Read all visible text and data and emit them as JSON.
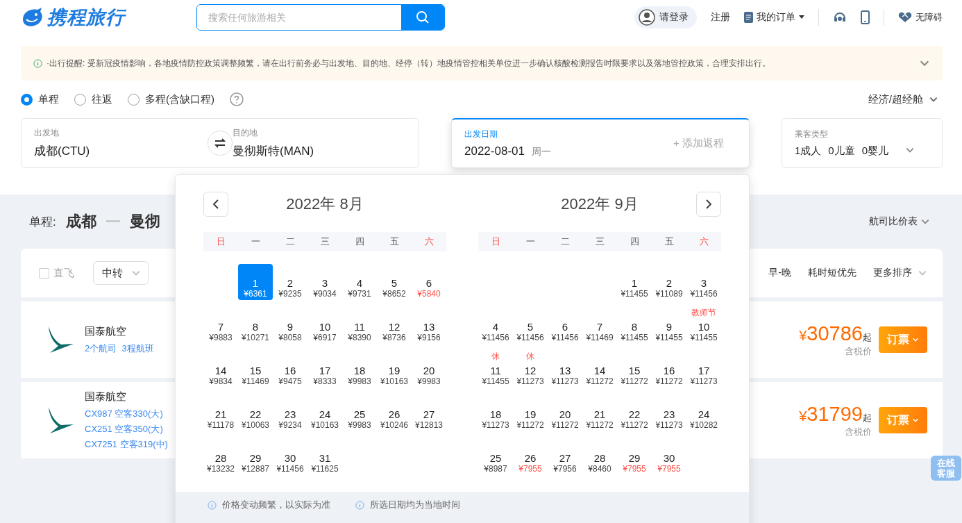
{
  "header": {
    "logo_text": "携程旅行",
    "search_placeholder": "搜索任何旅游相关",
    "login": "请登录",
    "register": "注册",
    "orders": "我的订单",
    "accessibility": "无障碍"
  },
  "notice": {
    "text": "·出行提醒: 受新冠疫情影响，各地疫情防控政策调整频繁，请在出行前务必与出发地、目的地、经停（转）地疫情管控相关单位进一步确认核酸检测报告时限要求以及落地管控政策，合理安排出行。"
  },
  "trip_types": [
    {
      "label": "单程",
      "selected": true
    },
    {
      "label": "往返",
      "selected": false
    },
    {
      "label": "多程(含缺口程)",
      "selected": false
    }
  ],
  "cabin": "经济/超经舱",
  "search": {
    "from": {
      "label": "出发地",
      "value": "成都(CTU)"
    },
    "to": {
      "label": "目的地",
      "value": "曼彻斯特(MAN)"
    },
    "date": {
      "label": "出发日期",
      "value": "2022-08-01",
      "weekday": "周一",
      "return": "+ 添加返程"
    },
    "passengers": {
      "label": "乘客类型",
      "values": [
        "1成人",
        "0儿童",
        "0婴儿"
      ]
    }
  },
  "results": {
    "trip_label": "单程:",
    "from": "成都",
    "to": "曼彻",
    "compare": "航司比价表",
    "direct": {
      "label": "直飞",
      "checked": false
    },
    "transfer": "中转",
    "sorts": [
      "早-晚",
      "耗时短优先",
      "更多排序"
    ],
    "flights": [
      {
        "airline": "国泰航空",
        "details": [
          "2个航司  3程航班"
        ],
        "currency": "¥",
        "amount": "30786",
        "suffix": "起",
        "tax": "含税价",
        "button": "订票"
      },
      {
        "airline": "国泰航空",
        "details": [
          "CX987 空客330(大)",
          "CX251 空客350(大)",
          "CX7251 空客319(中)"
        ],
        "currency": "¥",
        "amount": "31799",
        "suffix": "起",
        "tax": "含税价",
        "button": "订票"
      }
    ]
  },
  "online_service": "在线客服",
  "calendar": {
    "months": [
      {
        "title": "2022年 8月",
        "weekdays": [
          {
            "label": "日",
            "weekend": true
          },
          {
            "label": "一",
            "weekend": false
          },
          {
            "label": "二",
            "weekend": false
          },
          {
            "label": "三",
            "weekend": false
          },
          {
            "label": "四",
            "weekend": false
          },
          {
            "label": "五",
            "weekend": false
          },
          {
            "label": "六",
            "weekend": true
          }
        ],
        "weeks": [
          [
            {
              "kind": "empty"
            },
            {
              "kind": "day",
              "day": "1",
              "price": "¥6361",
              "low": false,
              "selected": true
            },
            {
              "kind": "day",
              "day": "2",
              "price": "¥9235",
              "low": false,
              "selected": false
            },
            {
              "kind": "day",
              "day": "3",
              "price": "¥9034",
              "low": false,
              "selected": false
            },
            {
              "kind": "day",
              "day": "4",
              "price": "¥9731",
              "low": false,
              "selected": false
            },
            {
              "kind": "day",
              "day": "5",
              "price": "¥8652",
              "low": false,
              "selected": false
            },
            {
              "kind": "day",
              "day": "6",
              "price": "¥5840",
              "low": true,
              "selected": false
            }
          ],
          [
            {
              "kind": "day",
              "day": "7",
              "price": "¥9883",
              "low": false,
              "selected": false
            },
            {
              "kind": "day",
              "day": "8",
              "price": "¥10271",
              "low": false,
              "selected": false
            },
            {
              "kind": "day",
              "day": "9",
              "price": "¥8058",
              "low": false,
              "selected": false
            },
            {
              "kind": "day",
              "day": "10",
              "price": "¥6917",
              "low": false,
              "selected": false
            },
            {
              "kind": "day",
              "day": "11",
              "price": "¥8390",
              "low": false,
              "selected": false
            },
            {
              "kind": "day",
              "day": "12",
              "price": "¥8736",
              "low": false,
              "selected": false
            },
            {
              "kind": "day",
              "day": "13",
              "price": "¥9156",
              "low": false,
              "selected": false
            }
          ],
          [
            {
              "kind": "day",
              "day": "14",
              "price": "¥9834",
              "low": false,
              "selected": false
            },
            {
              "kind": "day",
              "day": "15",
              "price": "¥11469",
              "low": false,
              "selected": false
            },
            {
              "kind": "day",
              "day": "16",
              "price": "¥9475",
              "low": false,
              "selected": false
            },
            {
              "kind": "day",
              "day": "17",
              "price": "¥8333",
              "low": false,
              "selected": false
            },
            {
              "kind": "day",
              "day": "18",
              "price": "¥9983",
              "low": false,
              "selected": false
            },
            {
              "kind": "day",
              "day": "19",
              "price": "¥10163",
              "low": false,
              "selected": false
            },
            {
              "kind": "day",
              "day": "20",
              "price": "¥9983",
              "low": false,
              "selected": false
            }
          ],
          [
            {
              "kind": "day",
              "day": "21",
              "price": "¥11178",
              "low": false,
              "selected": false
            },
            {
              "kind": "day",
              "day": "22",
              "price": "¥10063",
              "low": false,
              "selected": false
            },
            {
              "kind": "day",
              "day": "23",
              "price": "¥9234",
              "low": false,
              "selected": false
            },
            {
              "kind": "day",
              "day": "24",
              "price": "¥10163",
              "low": false,
              "selected": false
            },
            {
              "kind": "day",
              "day": "25",
              "price": "¥9983",
              "low": false,
              "selected": false
            },
            {
              "kind": "day",
              "day": "26",
              "price": "¥10246",
              "low": false,
              "selected": false
            },
            {
              "kind": "day",
              "day": "27",
              "price": "¥12813",
              "low": false,
              "selected": false
            }
          ],
          [
            {
              "kind": "day",
              "day": "28",
              "price": "¥13232",
              "low": false,
              "selected": false
            },
            {
              "kind": "day",
              "day": "29",
              "price": "¥12887",
              "low": false,
              "selected": false
            },
            {
              "kind": "day",
              "day": "30",
              "price": "¥11456",
              "low": false,
              "selected": false
            },
            {
              "kind": "day",
              "day": "31",
              "price": "¥11625",
              "low": false,
              "selected": false
            }
          ]
        ]
      },
      {
        "title": "2022年 9月",
        "weekdays": [
          {
            "label": "日",
            "weekend": true
          },
          {
            "label": "一",
            "weekend": false
          },
          {
            "label": "二",
            "weekend": false
          },
          {
            "label": "三",
            "weekend": false
          },
          {
            "label": "四",
            "weekend": false
          },
          {
            "label": "五",
            "weekend": false
          },
          {
            "label": "六",
            "weekend": true
          }
        ],
        "weeks": [
          [
            {
              "kind": "empty"
            },
            {
              "kind": "empty"
            },
            {
              "kind": "empty"
            },
            {
              "kind": "empty"
            },
            {
              "kind": "day",
              "day": "1",
              "price": "¥11455",
              "low": false,
              "selected": false
            },
            {
              "kind": "day",
              "day": "2",
              "price": "¥11089",
              "low": false,
              "selected": false
            },
            {
              "kind": "day",
              "day": "3",
              "price": "¥11456",
              "low": false,
              "selected": false
            }
          ],
          [
            {
              "kind": "day",
              "day": "4",
              "price": "¥11456",
              "low": false,
              "selected": false
            },
            {
              "kind": "day",
              "day": "5",
              "price": "¥11456",
              "low": false,
              "selected": false
            },
            {
              "kind": "day",
              "day": "6",
              "price": "¥11456",
              "low": false,
              "selected": false
            },
            {
              "kind": "day",
              "day": "7",
              "price": "¥11469",
              "low": false,
              "selected": false
            },
            {
              "kind": "day",
              "day": "8",
              "price": "¥11455",
              "low": false,
              "selected": false
            },
            {
              "kind": "day",
              "day": "9",
              "price": "¥11455",
              "low": false,
              "selected": false
            },
            {
              "kind": "day",
              "day": "10",
              "price": "¥11455",
              "low": false,
              "selected": false,
              "tag": "教师节"
            }
          ],
          [
            {
              "kind": "day",
              "day": "11",
              "price": "¥11455",
              "low": false,
              "selected": false,
              "tag": "休"
            },
            {
              "kind": "day",
              "day": "12",
              "price": "¥11273",
              "low": false,
              "selected": false,
              "tag": "休"
            },
            {
              "kind": "day",
              "day": "13",
              "price": "¥11273",
              "low": false,
              "selected": false
            },
            {
              "kind": "day",
              "day": "14",
              "price": "¥11272",
              "low": false,
              "selected": false
            },
            {
              "kind": "day",
              "day": "15",
              "price": "¥11272",
              "low": false,
              "selected": false
            },
            {
              "kind": "day",
              "day": "16",
              "price": "¥11272",
              "low": false,
              "selected": false
            },
            {
              "kind": "day",
              "day": "17",
              "price": "¥11273",
              "low": false,
              "selected": false
            }
          ],
          [
            {
              "kind": "day",
              "day": "18",
              "price": "¥11273",
              "low": false,
              "selected": false
            },
            {
              "kind": "day",
              "day": "19",
              "price": "¥11272",
              "low": false,
              "selected": false
            },
            {
              "kind": "day",
              "day": "20",
              "price": "¥11272",
              "low": false,
              "selected": false
            },
            {
              "kind": "day",
              "day": "21",
              "price": "¥11272",
              "low": false,
              "selected": false
            },
            {
              "kind": "day",
              "day": "22",
              "price": "¥11272",
              "low": false,
              "selected": false
            },
            {
              "kind": "day",
              "day": "23",
              "price": "¥11273",
              "low": false,
              "selected": false
            },
            {
              "kind": "day",
              "day": "24",
              "price": "¥10282",
              "low": false,
              "selected": false
            }
          ],
          [
            {
              "kind": "day",
              "day": "25",
              "price": "¥8987",
              "low": false,
              "selected": false
            },
            {
              "kind": "day",
              "day": "26",
              "price": "¥7955",
              "low": true,
              "selected": false
            },
            {
              "kind": "day",
              "day": "27",
              "price": "¥7956",
              "low": false,
              "selected": false
            },
            {
              "kind": "day",
              "day": "28",
              "price": "¥8460",
              "low": false,
              "selected": false
            },
            {
              "kind": "day",
              "day": "29",
              "price": "¥7955",
              "low": true,
              "selected": false
            },
            {
              "kind": "day",
              "day": "30",
              "price": "¥7955",
              "low": true,
              "selected": false
            }
          ]
        ]
      }
    ],
    "notes": [
      "价格变动频繁，以实际为准",
      "所选日期均为当地时间"
    ]
  }
}
